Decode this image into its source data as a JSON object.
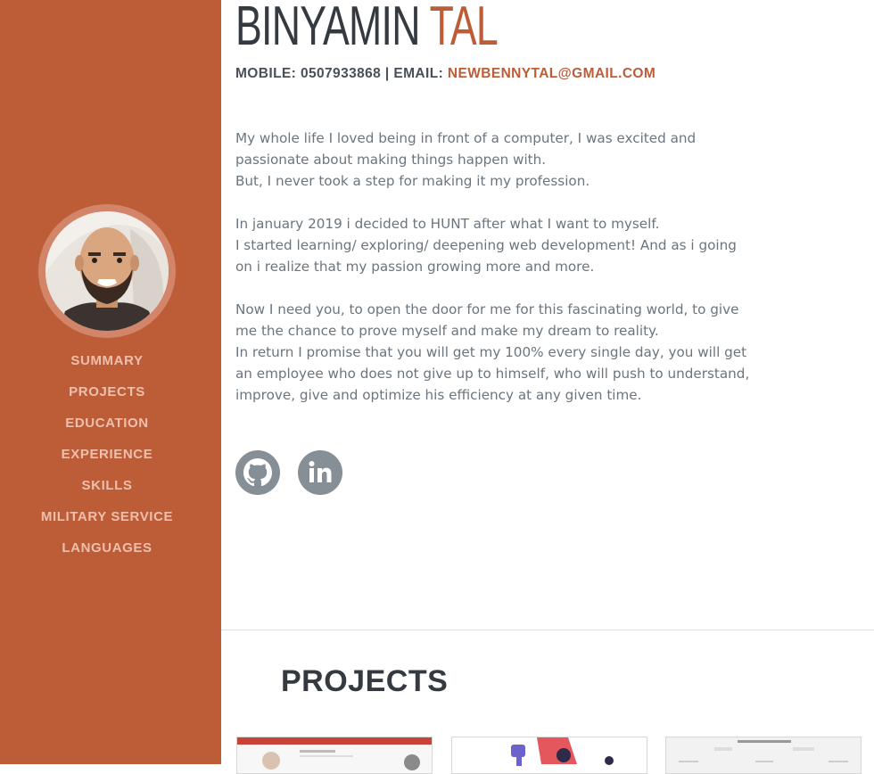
{
  "profile": {
    "first_name": "BINYAMIN",
    "last_name": "TAL",
    "mobile_label": "MOBILE:",
    "mobile": "0507933868",
    "separator": "|",
    "email_label": "EMAIL:",
    "email": "NEWBENNYTAL@GMAIL.COM"
  },
  "nav": {
    "items": [
      {
        "label": "SUMMARY"
      },
      {
        "label": "PROJECTS"
      },
      {
        "label": "EDUCATION"
      },
      {
        "label": "EXPERIENCE"
      },
      {
        "label": "SKILLS"
      },
      {
        "label": "MILITARY SERVICE"
      },
      {
        "label": "LANGUAGES"
      }
    ]
  },
  "summary": {
    "paragraphs": [
      [
        "My whole life I loved being in front of a computer, I was excited and",
        "passionate about making things happen with.",
        "But, I never took a step for making it my profession."
      ],
      [
        "In january 2019 i decided to HUNT after what I want to myself.",
        "I started learning/ exploring/ deepening web development! And as i going",
        "on i realize that my passion growing more and more."
      ],
      [
        "Now I need you, to open the door for me for this fascinating world, to give",
        "me the chance to prove myself and make my dream to reality.",
        "In return I promise that you will get my 100% every single day, you will get",
        "an employee who does not give up to himself, who will push to understand,",
        "improve, give and optimize his efficiency at any given time."
      ]
    ]
  },
  "social": {
    "icons": [
      "github-icon",
      "linkedin-icon"
    ]
  },
  "projects": {
    "title": "PROJECTS"
  },
  "colors": {
    "accent": "#bd5d38",
    "nav_text": "#eebfad",
    "heading": "#343a40",
    "body_text": "#6c757d"
  }
}
